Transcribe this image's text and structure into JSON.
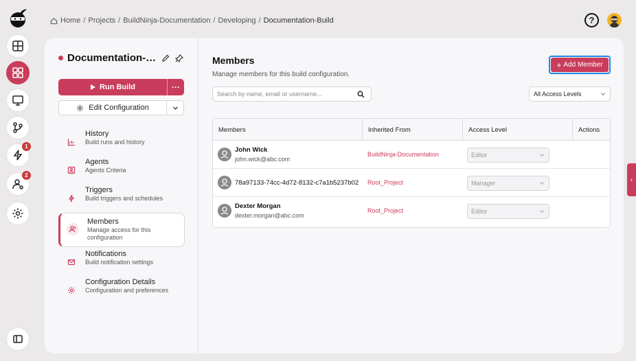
{
  "rail": {
    "items": [
      {
        "icon": "dashboard-icon"
      },
      {
        "icon": "grid-icon",
        "active": true
      },
      {
        "icon": "monitor-icon"
      },
      {
        "icon": "git-branch-icon"
      },
      {
        "icon": "lightning-icon",
        "badge": "1"
      },
      {
        "icon": "user-settings-icon",
        "badge": "2"
      },
      {
        "icon": "gear-icon"
      }
    ],
    "bottom_icon": "sidebar-toggle-icon"
  },
  "breadcrumb": [
    "Home",
    "Projects",
    "BuildNinja-Documentation",
    "Developing",
    "Documentation-Build"
  ],
  "header": {
    "help_label": "?"
  },
  "config": {
    "title": "Documentation-Build",
    "run_label": "Run Build",
    "more_label": "···",
    "edit_label": "Edit Configuration"
  },
  "nav": [
    {
      "title": "History",
      "sub": "Build runs and history",
      "icon": "chart-icon"
    },
    {
      "title": "Agents",
      "sub": "Agents Criteria",
      "icon": "agent-icon"
    },
    {
      "title": "Triggers",
      "sub": "Build triggers and schedules",
      "icon": "lightning-icon"
    },
    {
      "title": "Members",
      "sub": "Manage access for this configuration",
      "icon": "members-icon",
      "active": true
    },
    {
      "title": "Notifications",
      "sub": "Build notification settings",
      "icon": "mail-icon"
    },
    {
      "title": "Configuration Details",
      "sub": "Configuration and preferences",
      "icon": "gear-icon"
    }
  ],
  "members": {
    "title": "Members",
    "subtitle": "Manage members for this build configuration.",
    "add_label": "Add Member",
    "search_placeholder": "Search by name, email or username...",
    "access_filter": "All Access Levels",
    "columns": [
      "Members",
      "Inherited From",
      "Access Level",
      "Actions"
    ],
    "rows": [
      {
        "name": "John Wick",
        "email": "john.wick@abc.com",
        "inherited": "BuildNinja-Documentation",
        "access": "Editor"
      },
      {
        "name": "78a97133-74cc-4d72-8132-c7a1b5237b02",
        "email": "",
        "inherited": "Root_Project",
        "access": "Manager"
      },
      {
        "name": "Dexter Morgan",
        "email": "dexter.morgan@abc.com",
        "inherited": "Root_Project",
        "access": "Editor"
      }
    ]
  },
  "colors": {
    "accent": "#c93c5c",
    "focus": "#1e88e5",
    "badge": "#c93c3c"
  }
}
